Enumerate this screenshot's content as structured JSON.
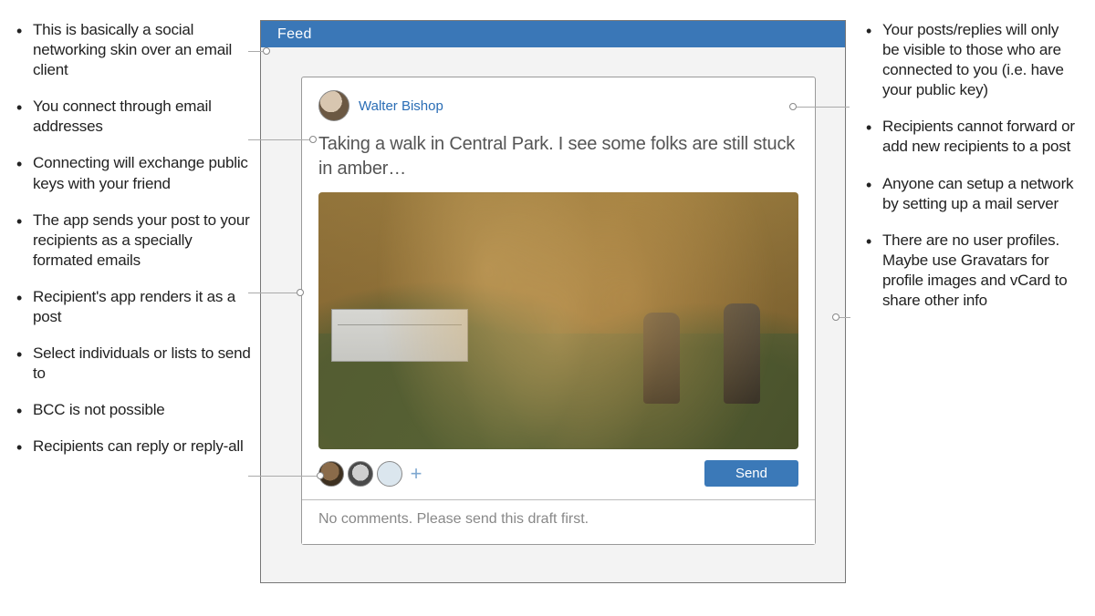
{
  "left_bullets": [
    "This is basically a social networking skin over an email client",
    "You connect through email addresses",
    "Connecting will exchange public keys with your friend",
    "The app sends your post to your recipients as a specially formated emails",
    "Recipient's app renders it as a post",
    "Select individuals or lists to send to",
    "BCC is not possible",
    "Recipients can reply or reply-all"
  ],
  "right_bullets": [
    "Your posts/replies will only be visible to those who are connected to you (i.e. have your public key)",
    "Recipients cannot forward or add new recipients to a post",
    "Anyone can setup a network by setting up a mail server",
    "There are no user profiles. Maybe use Gravatars for profile images and vCard to share other info"
  ],
  "app": {
    "header_title": "Feed",
    "author_name": "Walter Bishop",
    "post_text": "Taking a walk in Central Park. I see some folks are still stuck in amber…",
    "send_label": "Send",
    "comments_placeholder": "No comments. Please send this draft first.",
    "add_recipient_glyph": "+"
  }
}
